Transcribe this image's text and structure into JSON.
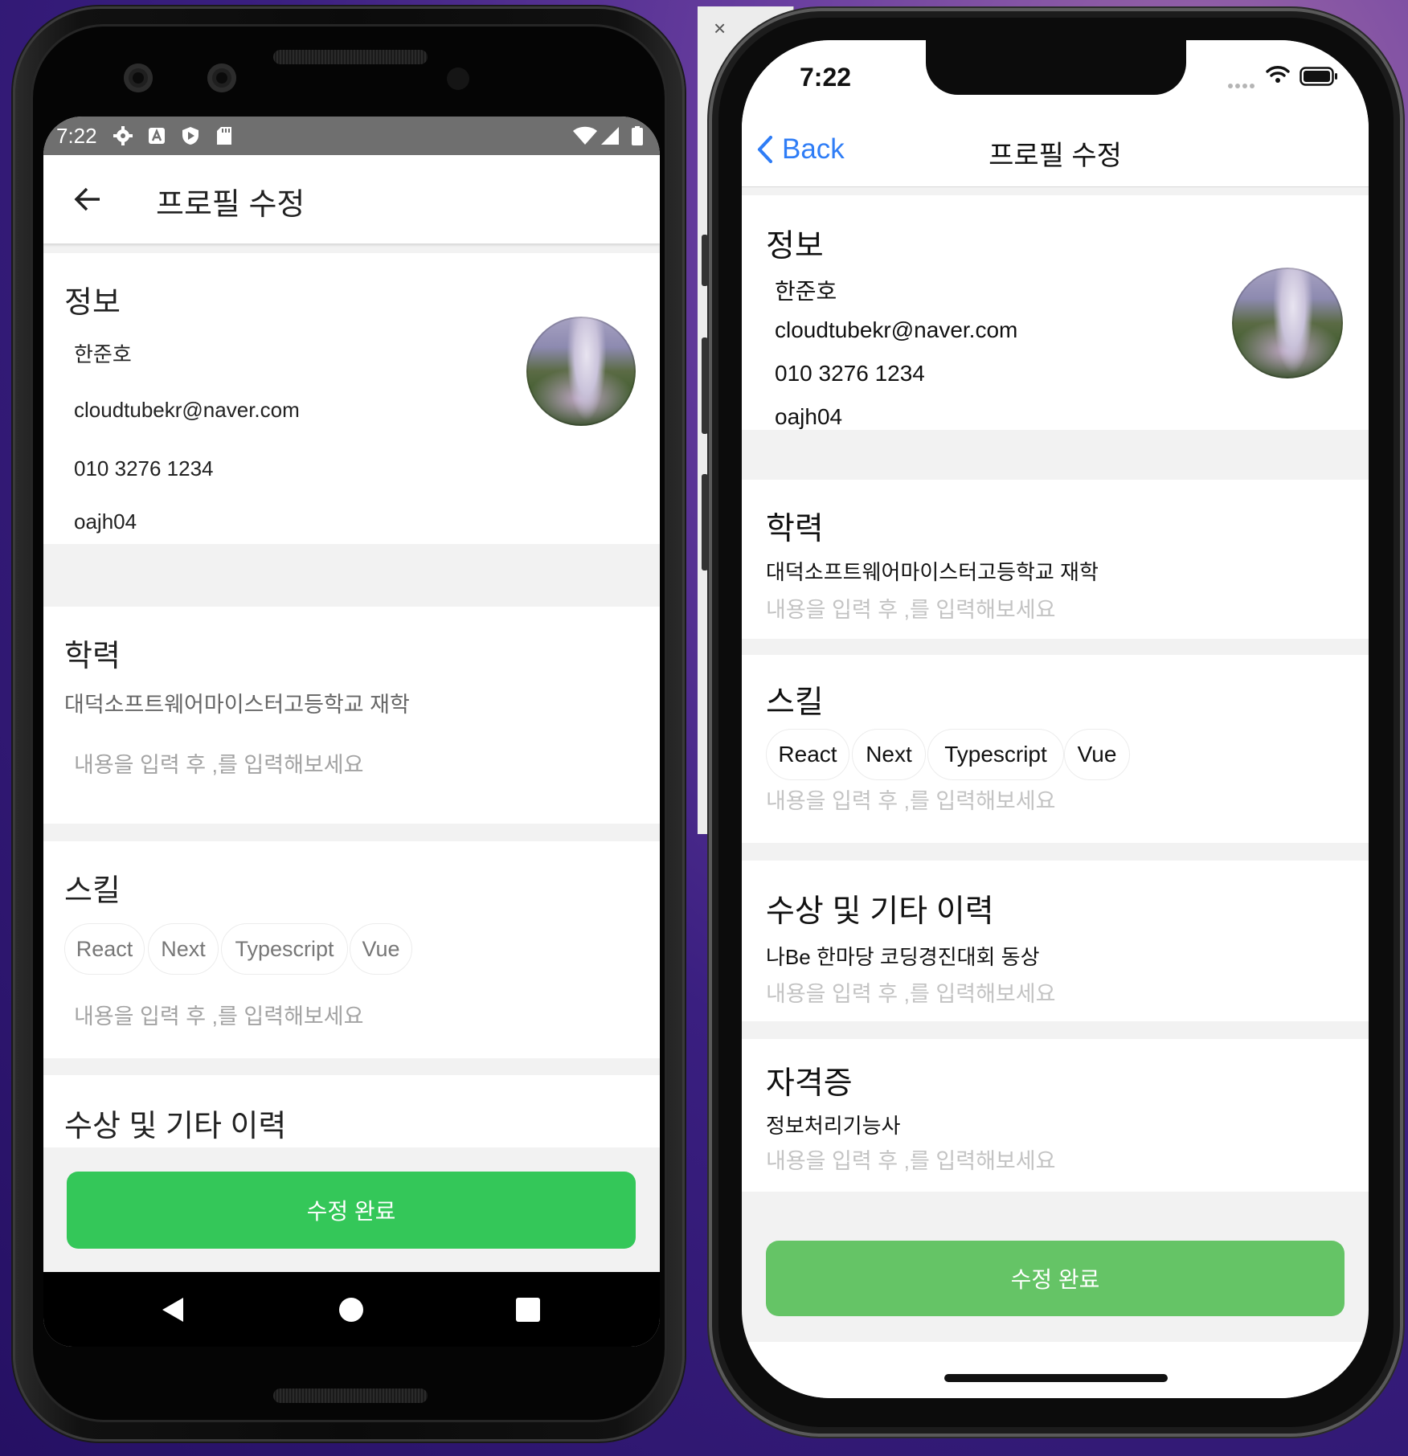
{
  "android": {
    "status": {
      "time": "7:22"
    },
    "title": "프로필 수정",
    "info": {
      "heading": "정보",
      "name": "한준호",
      "email": "cloudtubekr@naver.com",
      "phone": "010 3276 1234",
      "username": "oajh04"
    },
    "education": {
      "heading": "학력",
      "item": "대덕소프트웨어마이스터고등학교 재학",
      "placeholder": "내용을 입력 후 ,를 입력해보세요"
    },
    "skills": {
      "heading": "스킬",
      "chips": [
        "React",
        "Next",
        "Typescript",
        "Vue"
      ],
      "placeholder": "내용을 입력 후 ,를 입력해보세요"
    },
    "awards": {
      "heading": "수상 및 기타 이력"
    },
    "submit_label": "수정 완료"
  },
  "ios": {
    "status": {
      "time": "7:22"
    },
    "back_label": "Back",
    "title": "프로필 수정",
    "info": {
      "heading": "정보",
      "name": "한준호",
      "email": "cloudtubekr@naver.com",
      "phone": "010 3276 1234",
      "username": "oajh04"
    },
    "education": {
      "heading": "학력",
      "item": "대덕소프트웨어마이스터고등학교 재학",
      "placeholder": "내용을 입력 후 ,를 입력해보세요"
    },
    "skills": {
      "heading": "스킬",
      "chips": [
        "React",
        "Next",
        "Typescript",
        "Vue"
      ],
      "placeholder": "내용을 입력 후 ,를 입력해보세요"
    },
    "awards": {
      "heading": "수상 및 기타 이력",
      "item": "나Be 한마당 코딩경진대회 동상",
      "placeholder": "내용을 입력 후 ,를 입력해보세요"
    },
    "certificates": {
      "heading": "자격증",
      "item": "정보처리기능사",
      "placeholder": "내용을 입력 후 ,를 입력해보세요"
    },
    "submit_label": "수정 완료"
  },
  "simulator": {
    "close_glyph": "×"
  },
  "colors": {
    "android_button": "#34c759",
    "ios_button": "#65c466",
    "ios_accent": "#2f7df6",
    "placeholder": "#a3a3a3"
  }
}
